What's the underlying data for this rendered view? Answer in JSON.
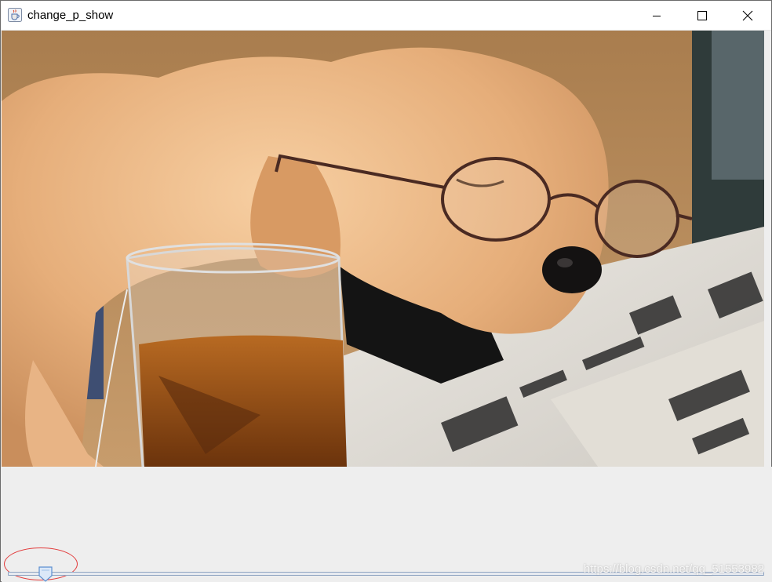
{
  "window": {
    "title": "change_p_show",
    "icon": "java-cup-icon",
    "controls": {
      "minimize": "minimize-icon",
      "maximize": "maximize-icon",
      "close": "close-icon"
    }
  },
  "image": {
    "subject": "sleeping puppy wearing glasses beside a glass of tea on a newspaper"
  },
  "slider": {
    "value_fraction": 0.05,
    "track_color": "#8fa4c2",
    "thumb_color": "#5b8fd0"
  },
  "annotation": {
    "color": "#e23b3b"
  },
  "watermark": {
    "text": "https://blog.csdn.net/qq_51553982"
  }
}
